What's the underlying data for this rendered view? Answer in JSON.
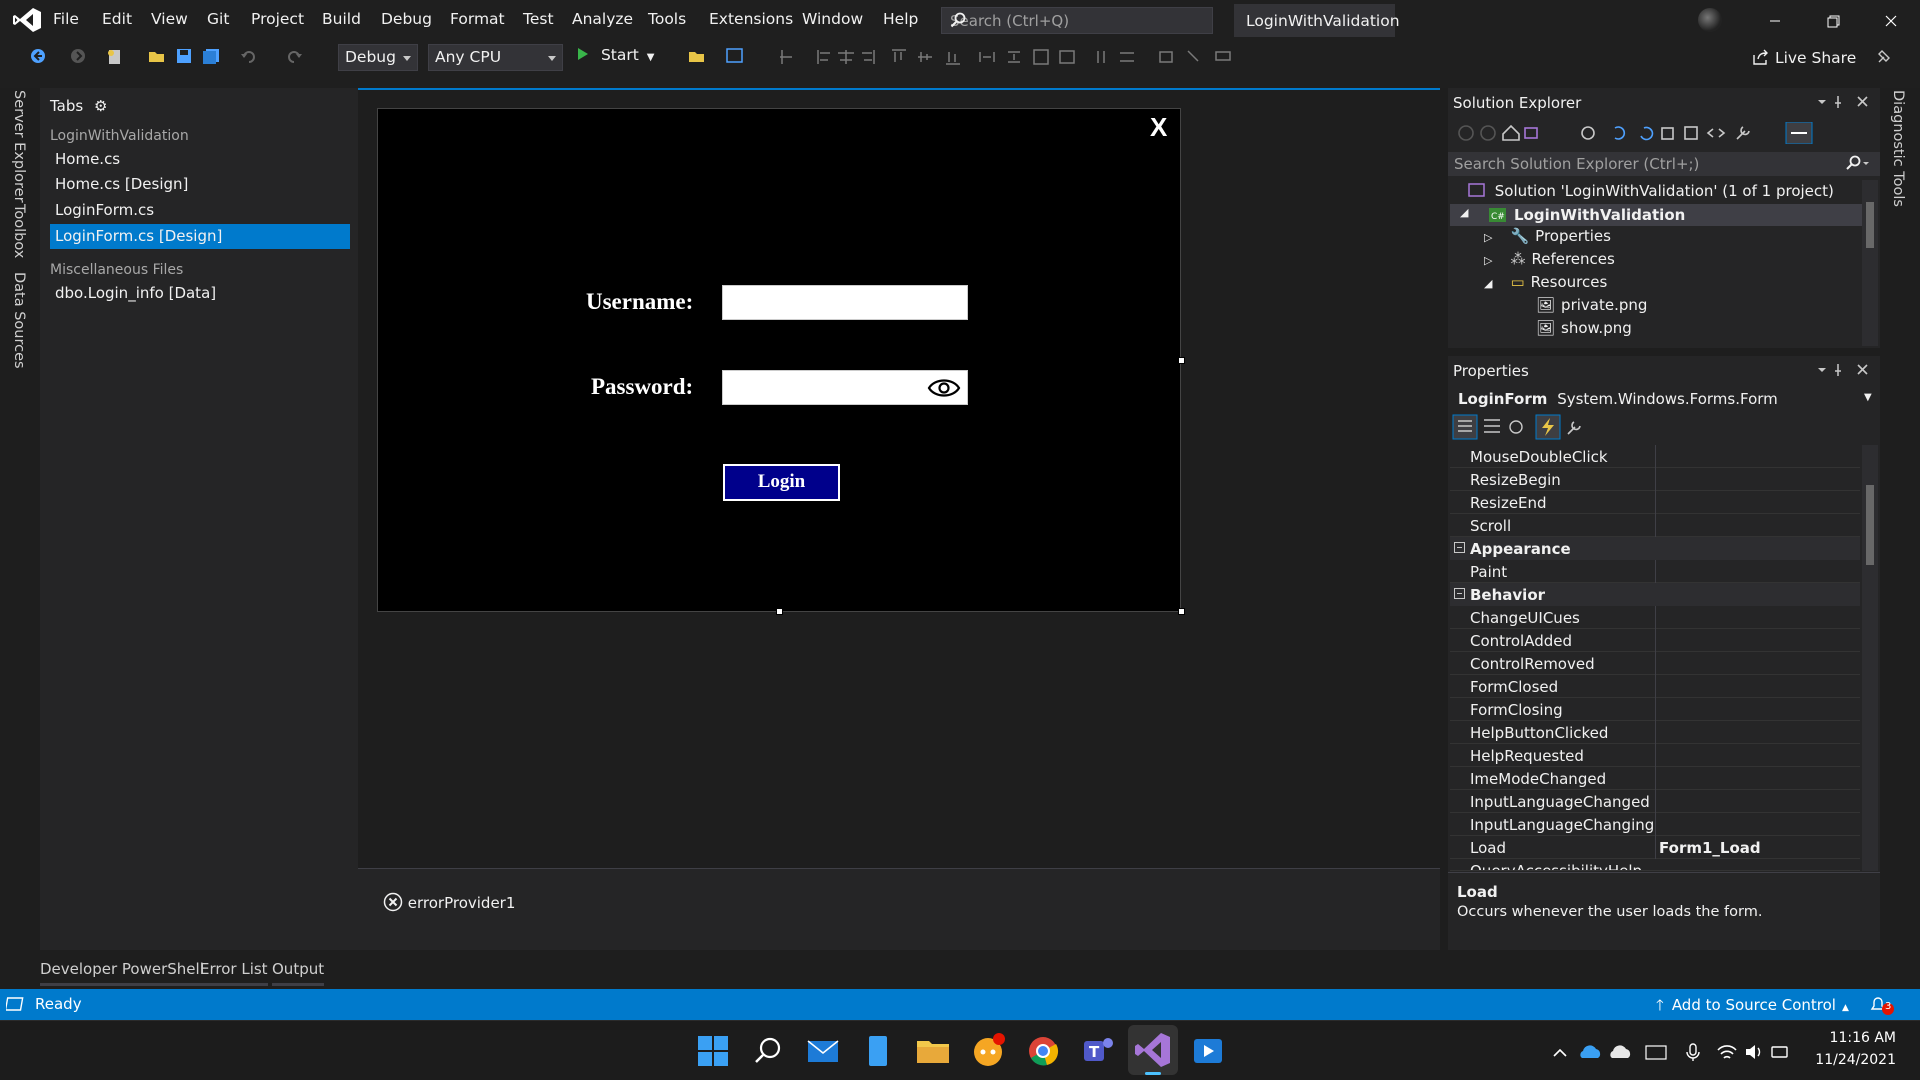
{
  "menu": [
    "File",
    "Edit",
    "View",
    "Git",
    "Project",
    "Build",
    "Debug",
    "Format",
    "Test",
    "Analyze",
    "Tools",
    "Extensions",
    "Window",
    "Help"
  ],
  "search": {
    "placeholder": "Search (Ctrl+Q)"
  },
  "window_title": "LoginWithValidation",
  "toolbar": {
    "config": "Debug",
    "platform": "Any CPU",
    "start_label": "Start",
    "live_share": "Live Share"
  },
  "left_rail": [
    "Server Explorer",
    "Toolbox",
    "Data Sources"
  ],
  "right_rail": [
    "Diagnostic Tools"
  ],
  "tabs_panel": {
    "title": "Tabs",
    "groups": [
      {
        "label": "LoginWithValidation",
        "items": [
          "Home.cs",
          "Home.cs [Design]",
          "LoginForm.cs",
          "LoginForm.cs [Design]"
        ]
      },
      {
        "label": "Miscellaneous Files",
        "items": [
          "dbo.Login_info [Data]"
        ]
      }
    ],
    "active_item": "LoginForm.cs [Design]"
  },
  "form": {
    "close": "X",
    "username_label": "Username:",
    "password_label": "Password:",
    "login_button": "Login"
  },
  "tray": {
    "component": "errorProvider1"
  },
  "solution_explorer": {
    "title": "Solution Explorer",
    "search_placeholder": "Search Solution Explorer (Ctrl+;)",
    "solution": "Solution 'LoginWithValidation' (1 of 1 project)",
    "project": "LoginWithValidation",
    "nodes": [
      "Properties",
      "References",
      "Resources"
    ],
    "resources": [
      "private.png",
      "show.png"
    ]
  },
  "properties": {
    "title": "Properties",
    "object_name": "LoginForm",
    "object_type": "System.Windows.Forms.Form",
    "rows_top": [
      "MouseDoubleClick",
      "ResizeBegin",
      "ResizeEnd",
      "Scroll"
    ],
    "category_appearance": "Appearance",
    "rows_appearance": [
      "Paint"
    ],
    "category_behavior": "Behavior",
    "rows_behavior": [
      "ChangeUICues",
      "ControlAdded",
      "ControlRemoved",
      "FormClosed",
      "FormClosing",
      "HelpButtonClicked",
      "HelpRequested",
      "ImeModeChanged",
      "InputLanguageChanged",
      "InputLanguageChanging"
    ],
    "load_row": {
      "name": "Load",
      "value": "Form1_Load"
    },
    "partial_row": "QueryAccessibilityHelp",
    "description_title": "Load",
    "description_text": "Occurs whenever the user loads the form."
  },
  "bottom_tabs": [
    "Developer PowerShell",
    "Error List",
    "Output"
  ],
  "status": {
    "ready": "Ready",
    "source_control": "Add to Source Control",
    "notifications": "3"
  },
  "clock": {
    "time": "11:16 AM",
    "date": "11/24/2021"
  },
  "colors": {
    "accent": "#007acc",
    "login_button": "#00008b"
  }
}
